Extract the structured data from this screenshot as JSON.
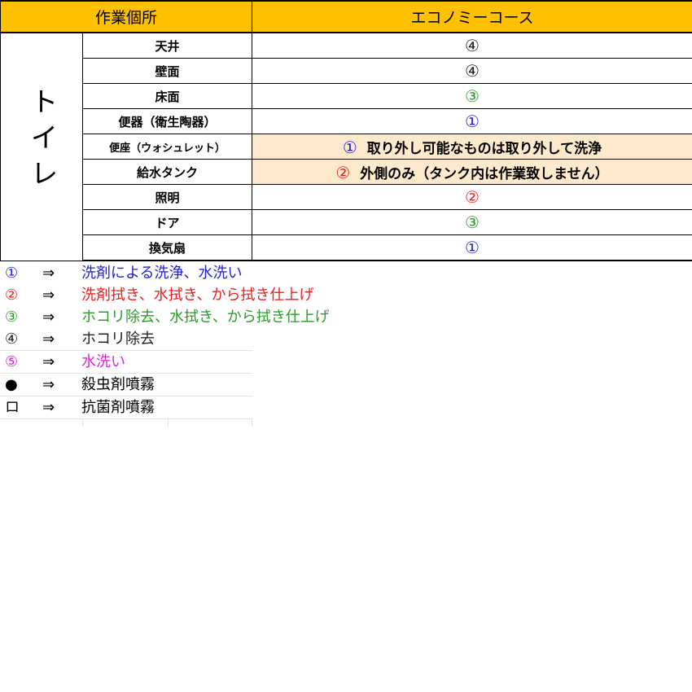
{
  "table": {
    "header_location": "作業個所",
    "header_course": "エコノミーコース",
    "area_label": "トイレ",
    "rows": [
      {
        "item": "天井",
        "value": "④",
        "color": "#222222"
      },
      {
        "item": "壁面",
        "value": "④",
        "color": "#222222"
      },
      {
        "item": "床面",
        "value": "③",
        "color": "#2a9a2a"
      },
      {
        "item": "便器（衛生陶器）",
        "value": "①",
        "color": "#1f1fd6"
      },
      {
        "item": "便座（ウォシュレット）",
        "mark": "①",
        "note": "取り外し可能なものは取り外して洗浄",
        "color": "#1f1fd6"
      },
      {
        "item": "給水タンク",
        "mark": "②",
        "note": "外側のみ（タンク内は作業致しません）",
        "color": "#ee1c1c"
      },
      {
        "item": "照明",
        "value": "②",
        "color": "#ee1c1c"
      },
      {
        "item": "ドア",
        "value": "③",
        "color": "#2a9a2a"
      },
      {
        "item": "換気扇",
        "value": "①",
        "color": "#1f1fd6"
      }
    ]
  },
  "legend": [
    {
      "symbol": "①",
      "arrow": "⇒",
      "desc": "洗剤による洗浄、水洗い",
      "color": "#1f1fd6"
    },
    {
      "symbol": "②",
      "arrow": "⇒",
      "desc": "洗剤拭き、水拭き、から拭き仕上げ",
      "color": "#ee1c1c"
    },
    {
      "symbol": "③",
      "arrow": "⇒",
      "desc": "ホコリ除去、水拭き、から拭き仕上げ",
      "color": "#2a9a2a"
    },
    {
      "symbol": "④",
      "arrow": "⇒",
      "desc": "ホコリ除去",
      "color": "#222222"
    },
    {
      "symbol": "⑤",
      "arrow": "⇒",
      "desc": "水洗い",
      "color": "#e01ee0"
    },
    {
      "symbol": "●",
      "arrow": "⇒",
      "desc": "殺虫剤噴霧",
      "color": "#000000"
    },
    {
      "symbol": "ロ",
      "arrow": "⇒",
      "desc": "抗菌剤噴霧",
      "color": "#000000"
    }
  ]
}
